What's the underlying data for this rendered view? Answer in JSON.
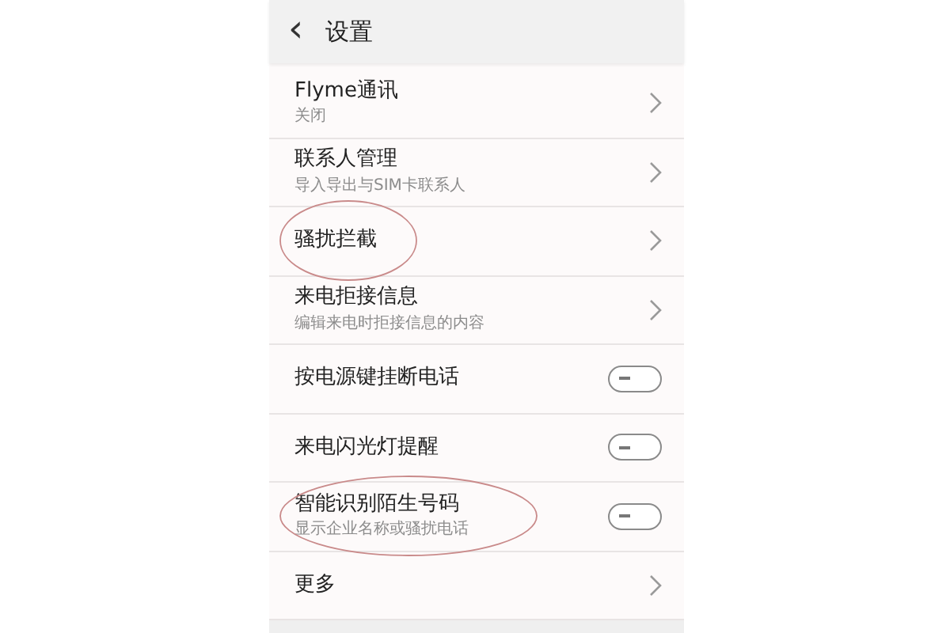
{
  "header": {
    "back_icon": "‹",
    "title": "设置"
  },
  "rows": [
    {
      "kind": "link",
      "title": "Flyme通讯",
      "subtitle": "关闭",
      "circled": false
    },
    {
      "kind": "link",
      "title": "联系人管理",
      "subtitle": "导入导出与SIM卡联系人",
      "circled": false
    },
    {
      "kind": "link",
      "title": "骚扰拦截",
      "circled": true
    },
    {
      "kind": "link",
      "title": "来电拒接信息",
      "subtitle": "编辑来电时拒接信息的内容",
      "circled": false
    },
    {
      "kind": "toggle",
      "title": "按电源键挂断电话",
      "on": false,
      "circled": false
    },
    {
      "kind": "toggle",
      "title": "来电闪光灯提醒",
      "on": false,
      "circled": false
    },
    {
      "kind": "toggle",
      "title": "智能识别陌生号码",
      "subtitle": "显示企业名称或骚扰电话",
      "on": false,
      "circled": true
    },
    {
      "kind": "link",
      "title": "更多",
      "circled": false
    }
  ]
}
